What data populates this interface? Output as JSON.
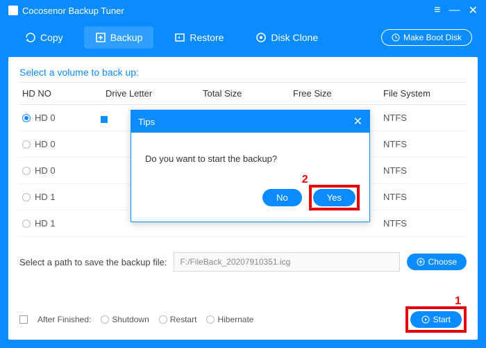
{
  "title": "Cocosenor Backup Tuner",
  "toolbar": {
    "copy": "Copy",
    "backup": "Backup",
    "restore": "Restore",
    "diskclone": "Disk Clone",
    "bootdisk": "Make Boot Disk"
  },
  "section_title": "Select a volume to back up:",
  "columns": {
    "c1": "HD NO",
    "c2": "Drive Letter",
    "c3": "Total Size",
    "c4": "Free Size",
    "c5": "File System"
  },
  "rows": [
    {
      "hd": "HD 0",
      "fs": "NTFS",
      "selected": true
    },
    {
      "hd": "HD 0",
      "fs": "NTFS",
      "selected": false
    },
    {
      "hd": "HD 0",
      "fs": "NTFS",
      "selected": false
    },
    {
      "hd": "HD 1",
      "fs": "NTFS",
      "selected": false
    },
    {
      "hd": "HD 1",
      "fs": "NTFS",
      "selected": false
    }
  ],
  "path_label": "Select a path to save the backup file:",
  "path_value": "F:/FileBack_20207910351.icg",
  "choose": "Choose",
  "after_finished": "After Finished:",
  "opts": {
    "shutdown": "Shutdown",
    "restart": "Restart",
    "hibernate": "Hibernate"
  },
  "start": "Start",
  "dialog": {
    "title": "Tips",
    "message": "Do you want to start the backup?",
    "no": "No",
    "yes": "Yes"
  },
  "annot": {
    "one": "1",
    "two": "2"
  }
}
